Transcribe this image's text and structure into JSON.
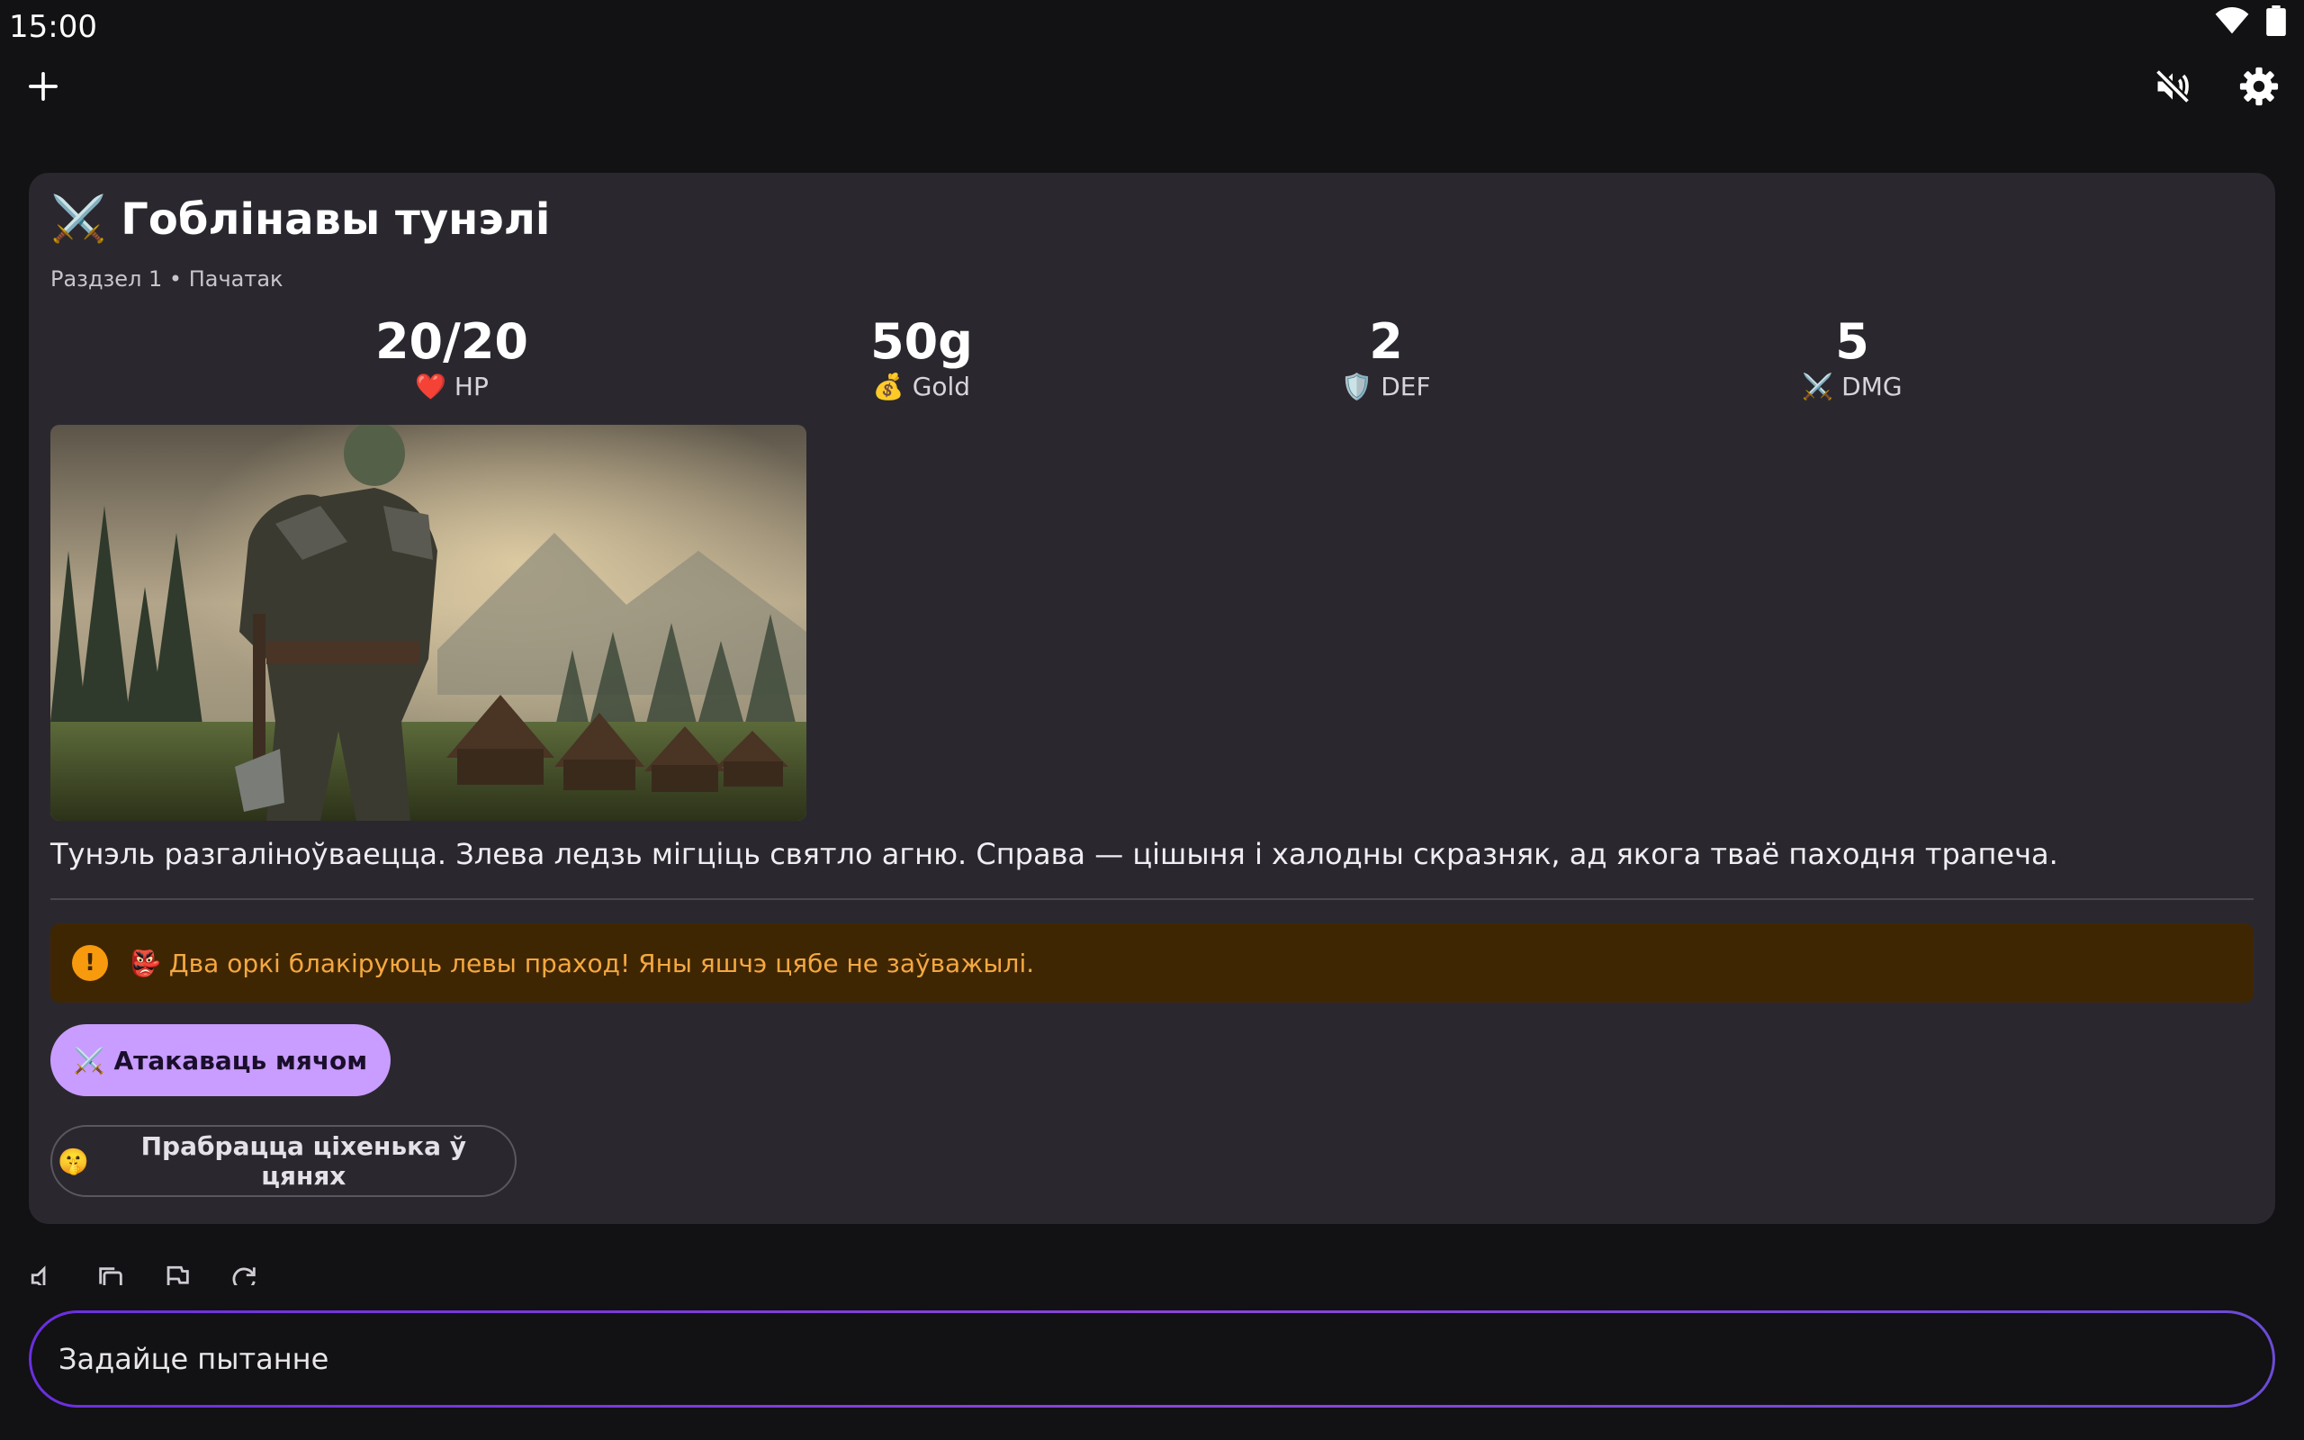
{
  "status_bar": {
    "time": "15:00"
  },
  "card": {
    "title_emoji": "⚔️",
    "title": "Гоблінавы тунэлі",
    "subtitle": "Раздзел 1 • Пачатак",
    "stats": [
      {
        "value": "20/20",
        "emoji": "❤️",
        "label": "HP"
      },
      {
        "value": "50g",
        "emoji": "💰",
        "label": "Gold"
      },
      {
        "value": "2",
        "emoji": "🛡️",
        "label": "DEF"
      },
      {
        "value": "5",
        "emoji": "⚔️",
        "label": "DMG"
      }
    ],
    "narration": "Тунэль разгаліноўваецца. Злева ледзь мігціць святло агню. Справа — цішыня і халодны скразняк, ад якога тваё паходня трапеча.",
    "alert": {
      "icon": "!",
      "emoji": "👺",
      "text": "Два оркі блакіруюць левы праход! Яны яшчэ цябе не заўважылі."
    },
    "actions": {
      "primary": {
        "emoji": "⚔️",
        "label": "Атакаваць мячом"
      },
      "secondary": {
        "emoji": "🤫",
        "label": "Прабрацца ціхенька ў цянях"
      }
    }
  },
  "composer": {
    "placeholder": "Задайце пытанне"
  },
  "colors": {
    "accent": "#c99cff",
    "alert_bg": "#3f2603",
    "alert_text": "#f5a840",
    "card_bg": "#2a282e"
  }
}
